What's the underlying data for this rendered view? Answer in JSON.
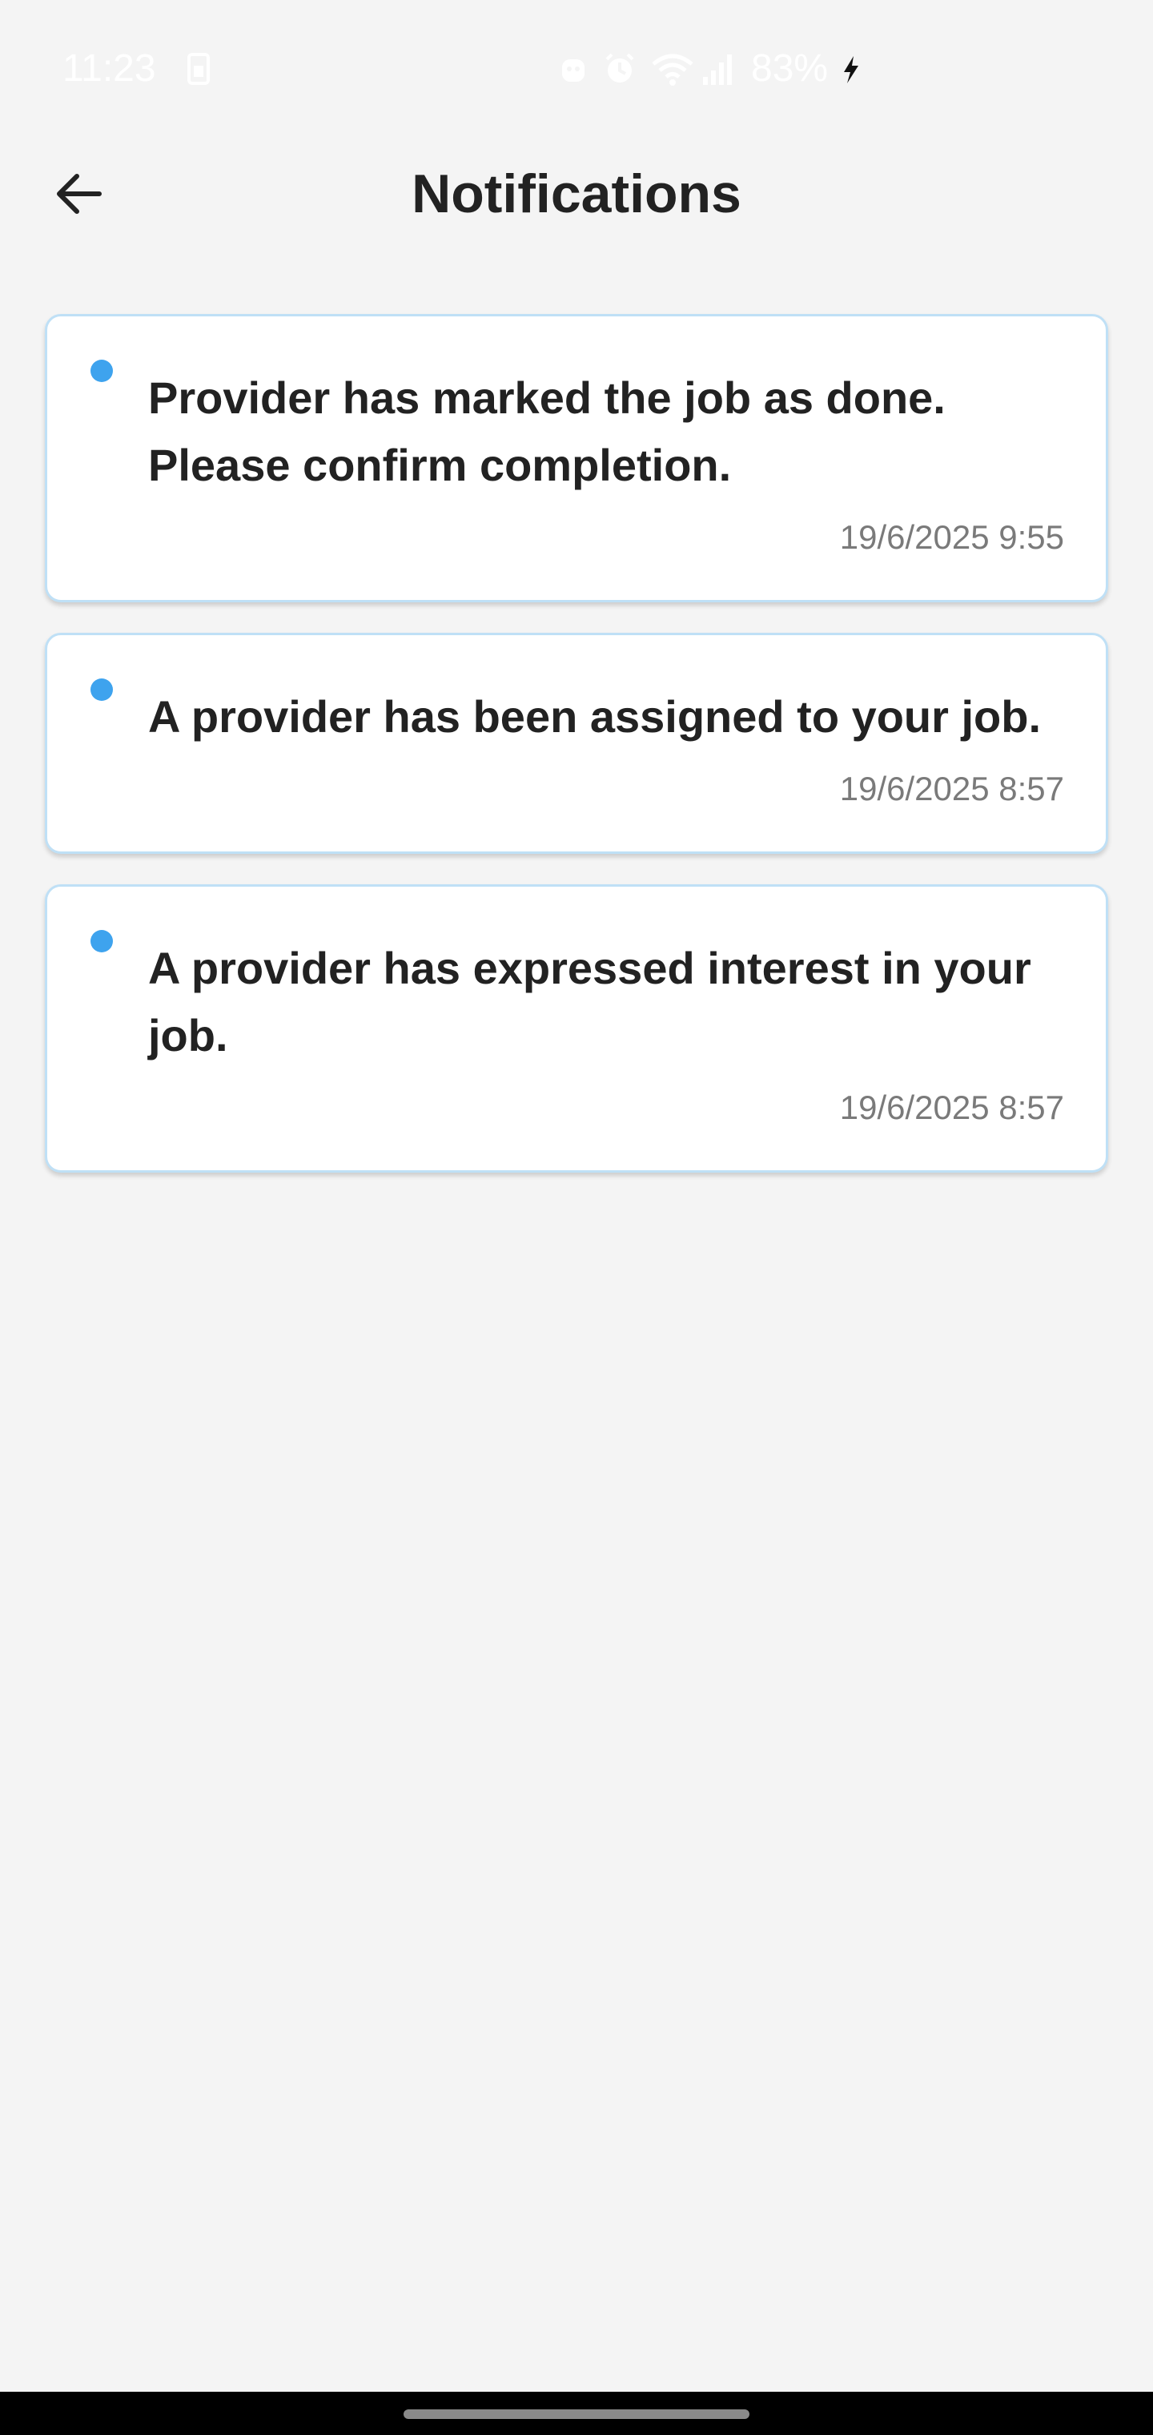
{
  "status_bar": {
    "time": "11:23",
    "battery": "83%",
    "icons": [
      "sim-icon",
      "android-icon",
      "alarm-icon",
      "wifi-icon",
      "signal-icon",
      "charging-icon"
    ]
  },
  "header": {
    "title": "Notifications",
    "back_icon": "arrow-left-icon"
  },
  "notifications": [
    {
      "message": "Provider has marked the job as done. Please confirm completion.",
      "time": "19/6/2025 9:55",
      "unread": true
    },
    {
      "message": "A provider has been assigned to your job.",
      "time": "19/6/2025 8:57",
      "unread": true
    },
    {
      "message": "A provider has expressed interest in your job.",
      "time": "19/6/2025 8:57",
      "unread": true
    }
  ],
  "colors": {
    "background": "#f4f4f4",
    "card": "#ffffff",
    "card_border": "#bfe0f6",
    "unread_dot": "#3ea3ee",
    "text": "#222222",
    "timestamp": "#7a7a7a"
  }
}
